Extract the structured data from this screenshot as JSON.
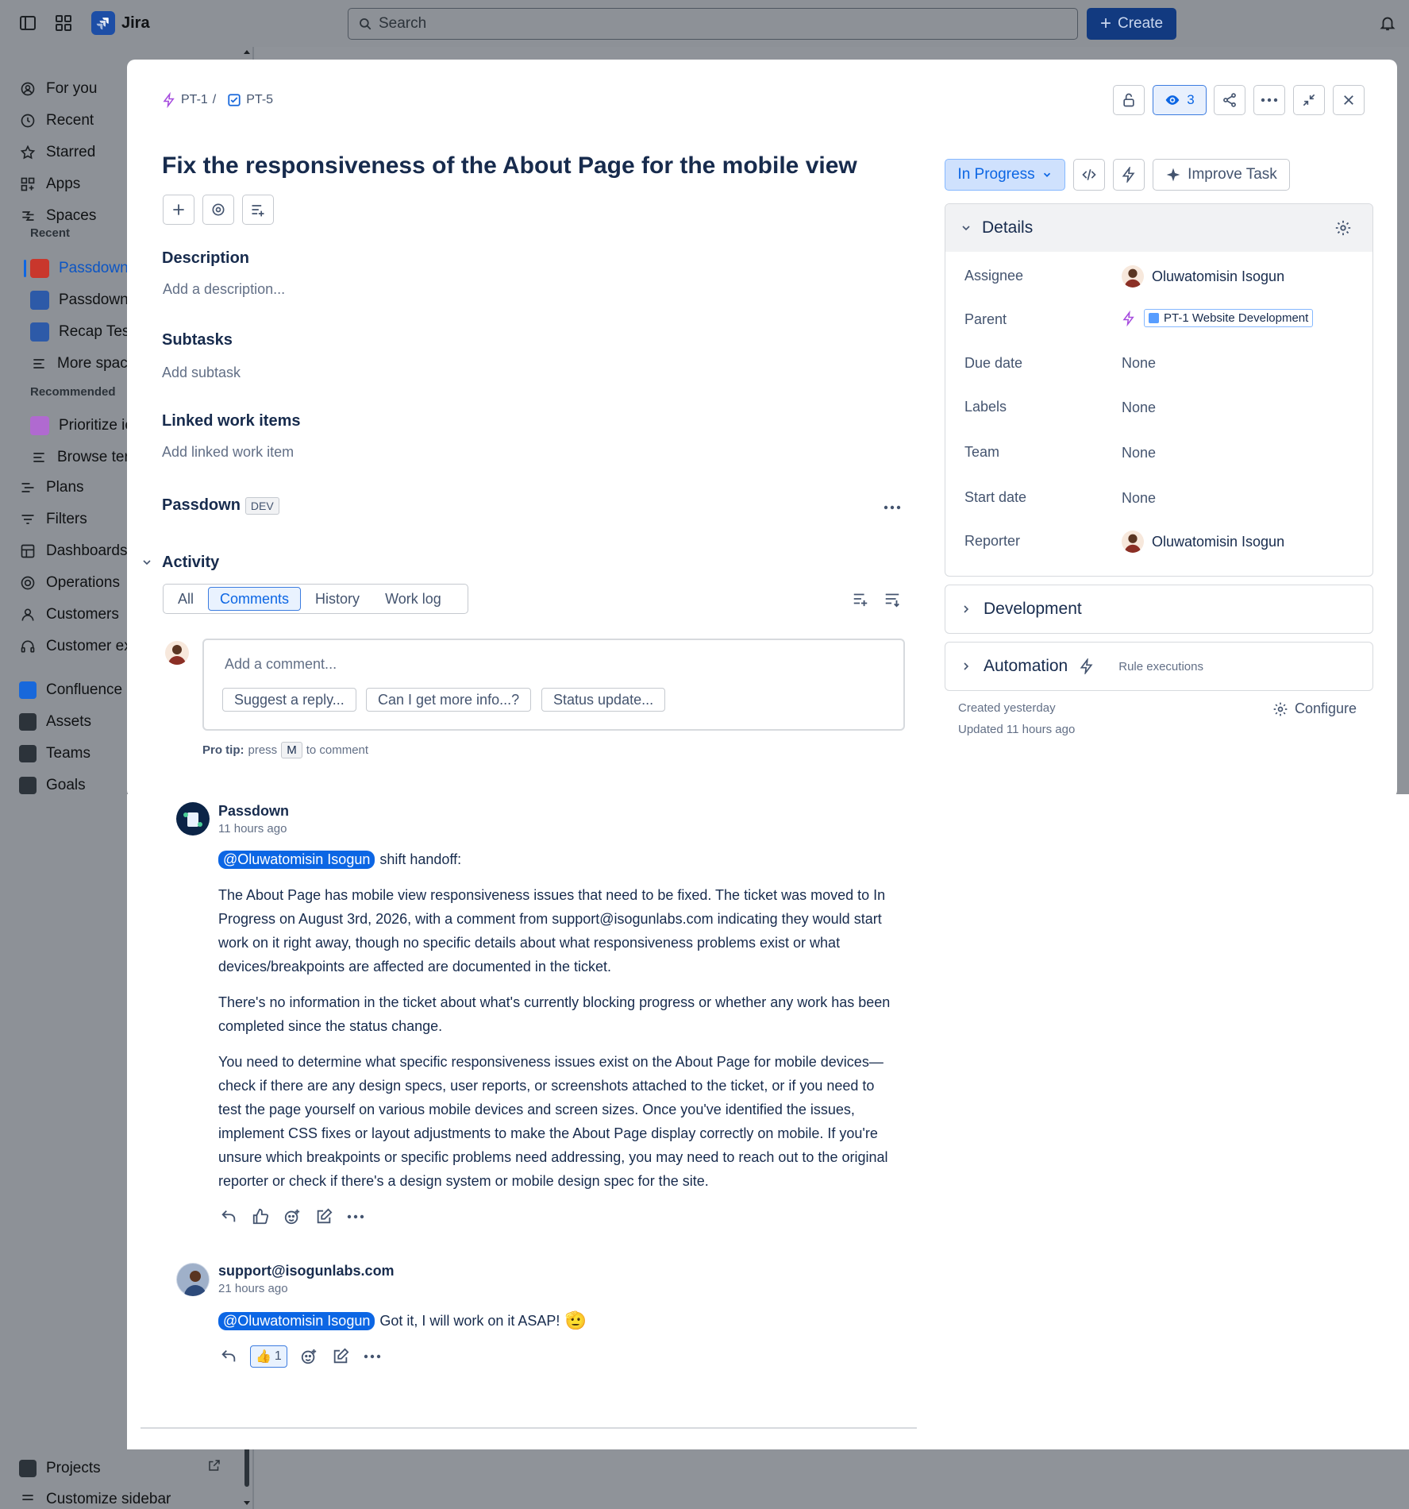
{
  "app": {
    "name": "Jira"
  },
  "topbar": {
    "search_placeholder": "Search",
    "create_label": "Create"
  },
  "sidebar": {
    "items_top": [
      "For you",
      "Recent",
      "Starred",
      "Apps",
      "Spaces"
    ],
    "recent_label": "Recent",
    "recent_spaces": [
      "Passdown-",
      "Passdown",
      "Recap Test",
      "More spaces"
    ],
    "recommended_label": "Recommended",
    "recommended": [
      "Prioritize ic",
      "Browse ter"
    ],
    "items_mid": [
      "Plans",
      "Filters",
      "Dashboards",
      "Operations",
      "Customers",
      "Customer ex"
    ],
    "apps": [
      "Confluence",
      "Assets",
      "Teams",
      "Goals"
    ],
    "projects": "Projects",
    "customize": "Customize sidebar"
  },
  "issue": {
    "breadcrumb": {
      "parent": "PT-1",
      "separator": "/",
      "key": "PT-5"
    },
    "watchers": "3",
    "title": "Fix the responsiveness of the About Page for the mobile view",
    "description": {
      "heading": "Description",
      "placeholder": "Add a description..."
    },
    "subtasks": {
      "heading": "Subtasks",
      "action": "Add subtask"
    },
    "linked": {
      "heading": "Linked work items",
      "action": "Add linked work item"
    },
    "passdown": {
      "heading": "Passdown",
      "badge": "DEV"
    },
    "activity": {
      "heading": "Activity",
      "tabs": [
        "All",
        "Comments",
        "History",
        "Work log"
      ],
      "active_tab": "Comments",
      "comment_placeholder": "Add a comment...",
      "suggestions": [
        "Suggest a reply...",
        "Can I get more info...?",
        "Status update..."
      ],
      "protip": {
        "label": "Pro tip:",
        "pre": "press",
        "key": "M",
        "post": "to comment"
      }
    }
  },
  "comments": [
    {
      "author": "Passdown",
      "time": "11 hours ago",
      "mention": "@Oluwatomisin Isogun",
      "lead": "shift handoff:",
      "paragraphs": [
        "The About Page has mobile view responsiveness issues that need to be fixed. The ticket was moved to In Progress on August 3rd, 2026, with a comment from support@isogunlabs.com indicating they would start work on it right away, though no specific details about what responsiveness problems exist or what devices/breakpoints are affected are documented in the ticket.",
        "There's no information in the ticket about what's currently blocking progress or whether any work has been completed since the status change.",
        "You need to determine what specific responsiveness issues exist on the About Page for mobile devices—check if there are any design specs, user reports, or screenshots attached to the ticket, or if you need to test the page yourself on various mobile devices and screen sizes. Once you've identified the issues, implement CSS fixes or layout adjustments to make the About Page display correctly on mobile. If you're unsure which breakpoints or specific problems need addressing, you may need to reach out to the original reporter or check if there's a design system or mobile design spec for the site."
      ]
    },
    {
      "author": "support@isogunlabs.com",
      "time": "21 hours ago",
      "mention": "@Oluwatomisin Isogun",
      "lead": "Got it, I will work on it ASAP!",
      "emoji": "🫡",
      "reaction": {
        "emoji": "👍",
        "count": "1"
      }
    }
  ],
  "side": {
    "status": "In Progress",
    "improve": "Improve Task",
    "details": {
      "heading": "Details",
      "rows": [
        {
          "label": "Assignee",
          "value": "Oluwatomisin Isogun"
        },
        {
          "label": "Parent",
          "value": "PT-1 Website Development"
        },
        {
          "label": "Due date",
          "value": "None"
        },
        {
          "label": "Labels",
          "value": "None"
        },
        {
          "label": "Team",
          "value": "None"
        },
        {
          "label": "Start date",
          "value": "None"
        },
        {
          "label": "Reporter",
          "value": "Oluwatomisin Isogun"
        }
      ]
    },
    "development": "Development",
    "automation": {
      "heading": "Automation",
      "sub": "Rule executions"
    },
    "created": "Created yesterday",
    "updated": "Updated 11 hours ago",
    "configure": "Configure"
  },
  "colors": {
    "accent": "#0c66e4",
    "create_bg": "#123a80",
    "status_bg": "#cfe1fd",
    "mention_bg": "#0c66e4"
  }
}
